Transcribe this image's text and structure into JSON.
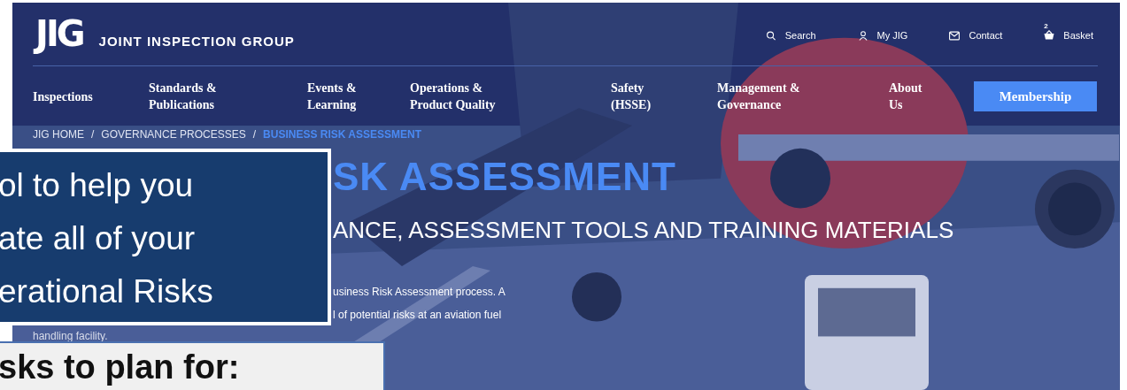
{
  "header": {
    "logo": "JIG",
    "site_name": "JOINT INSPECTION GROUP",
    "utility_links": [
      {
        "kind": "search",
        "label": "Search"
      },
      {
        "kind": "account",
        "label": "My JIG"
      },
      {
        "kind": "contact",
        "label": "Contact"
      },
      {
        "kind": "basket",
        "label": "Basket",
        "count": "2"
      }
    ]
  },
  "nav": {
    "items": [
      {
        "label": "Inspections"
      },
      {
        "label": "Standards & Publications"
      },
      {
        "label": "Events & Learning"
      },
      {
        "label": "Operations & Product Quality"
      },
      {
        "label": "Safety (HSSE)"
      },
      {
        "label": "Management & Governance"
      },
      {
        "label": "About Us"
      }
    ],
    "button": "Membership"
  },
  "breadcrumb_separator": "/",
  "breadcrumb": [
    {
      "label": "JIG HOME",
      "current": false
    },
    {
      "label": "GOVERNANCE PROCESSES",
      "current": false
    },
    {
      "label": "BUSINESS RISK ASSESSMENT",
      "current": true
    }
  ],
  "hero": {
    "title": "SK ASSESSMENT",
    "subtitle": "ANCE, ASSESSMENT TOOLS AND TRAINING MATERIALS",
    "paragraph_lines": [
      "usiness Risk Assessment process. A",
      "l of potential risks at an aviation fuel",
      "handling facility."
    ]
  },
  "callouts": [
    {
      "kind": "dark",
      "lines": [
        "ol to help you",
        "ate all of your",
        "erational Risks"
      ]
    },
    {
      "kind": "light",
      "lines": [
        "sks to plan for:"
      ]
    }
  ]
}
